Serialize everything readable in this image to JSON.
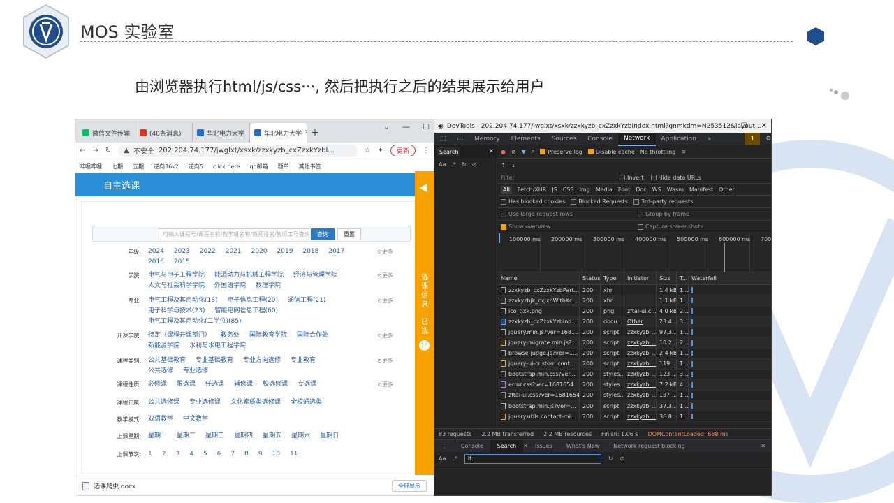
{
  "slide": {
    "title": "MOS 实验室",
    "subtitle": "由浏览器执行html/js/css···, 然后把执行之后的结果展示给用户"
  },
  "browser": {
    "tabs": [
      {
        "label": "微信文件传输",
        "color": "#07c160"
      },
      {
        "label": "(48条消息)",
        "color": "#d9381e"
      },
      {
        "label": "华北电力大学",
        "color": "#2b6ac6"
      },
      {
        "label": "华北电力大学",
        "color": "#2b6ac6"
      }
    ],
    "insecure": "不安全",
    "url": "202.204.74.177/jwglxt/xsxk/zzxkyzb_cxZzxkYzbl...",
    "update": "更新",
    "bookmarks": [
      "哔哩哔哩",
      "七期",
      "五期",
      "逆向36k2",
      "逆向5",
      "click here",
      "qq邮箱",
      "题单",
      "其他书签"
    ],
    "page_header": "自主选课",
    "search_placeholder": "可输入课程号/课程名称/教学班名称/教师姓名/教师工号查询",
    "query_btn": "查询",
    "reset_btn": "重置",
    "more": "⊙更多",
    "filters": [
      {
        "label": "年级:",
        "options": [
          "2024",
          "2023",
          "2022",
          "2021",
          "2020",
          "2019",
          "2018",
          "2017",
          "2016",
          "2015"
        ],
        "more": true
      },
      {
        "label": "学院:",
        "options": [
          "电气与电子工程学院",
          "能源动力与机械工程学院",
          "经济与管理学院",
          "人文与社会科学学院",
          "外国语学院",
          "数理学院"
        ],
        "more": true
      },
      {
        "label": "专业:",
        "options": [
          "电气工程及其自动化(18)",
          "电子信息工程(20)",
          "通信工程(21)",
          "电子科学与技术(23)",
          "智能电网信息工程(60)",
          "电气工程及其自动化(二学位)(85)"
        ],
        "more": true
      },
      {
        "label": "开课学院:",
        "options": [
          "待定（课程开课部门）",
          "教务处",
          "国际教育学院",
          "国际合作处",
          "新能源学院",
          "水利与水电工程学院"
        ],
        "more": true
      },
      {
        "label": "课程类别:",
        "options": [
          "公共基础教育",
          "专业基础教育",
          "专业方向选修",
          "专业教育",
          "公共选修",
          "专业选修"
        ],
        "more": true
      },
      {
        "label": "课程性质:",
        "options": [
          "必修课",
          "限选课",
          "任选课",
          "辅修课",
          "校选修课",
          "专选课"
        ],
        "more": true
      },
      {
        "label": "课程归属:",
        "options": [
          "公共选修课",
          "专业选修课",
          "文化素质类选修课",
          "全校通选类"
        ],
        "more": false
      },
      {
        "label": "教学模式:",
        "options": [
          "双语教学",
          "中文教学"
        ],
        "more": false
      },
      {
        "label": "上课星期:",
        "options": [
          "星期一",
          "星期二",
          "星期三",
          "星期四",
          "星期五",
          "星期六",
          "星期日"
        ],
        "more": false
      },
      {
        "label": "上课节次:",
        "options": [
          "1",
          "2",
          "3",
          "4",
          "5",
          "6",
          "7",
          "8",
          "9",
          "10",
          "11"
        ],
        "more": false
      }
    ],
    "side_selected": "选课信息",
    "side_selected2": "已选",
    "side_count": "13",
    "download_file": "选课爬虫.docx",
    "show_all": "全部显示"
  },
  "devtools": {
    "title": "DevTools - 202.204.74.177/jwglxt/xsxk/zzxkyzb_cxZzxkYzbIndex.html?gnmkdm=N253512&layout...",
    "tabs": [
      "Memory",
      "Elements",
      "Sources",
      "Console",
      "Network",
      "Application",
      "»"
    ],
    "active_tab": "Network",
    "issues_badge": "1",
    "search_label": "Search",
    "preserve_log": "Preserve log",
    "disable_cache": "Disable cache",
    "throttling": "No throttling",
    "filter_placeholder": "Filter",
    "invert": "Invert",
    "hide_data_urls": "Hide data URLs",
    "types": [
      "All",
      "Fetch/XHR",
      "JS",
      "CSS",
      "Img",
      "Media",
      "Font",
      "Doc",
      "WS",
      "Wasm",
      "Manifest",
      "Other"
    ],
    "has_blocked": "Has blocked cookies",
    "blocked_requests": "Blocked Requests",
    "third_party": "3rd-party requests",
    "large_rows": "Use large request rows",
    "group_frame": "Group by frame",
    "show_overview": "Show overview",
    "capture_screens": "Capture screenshots",
    "overview_ticks": [
      "100000 ms",
      "200000 ms",
      "300000 ms",
      "400000 ms",
      "500000 ms",
      "600000 ms",
      "700"
    ],
    "columns": [
      "Name",
      "Status",
      "Type",
      "Initiator",
      "Size",
      "T...",
      "Waterfall"
    ],
    "requests": [
      {
        "name": "zzxkyzb_cxZzxkYzbPart...",
        "status": "200",
        "type": "xhr",
        "initiator": "",
        "size": "1.4 kB",
        "time": "1...",
        "kind": "doc0"
      },
      {
        "name": "zzxkyzbjk_cxJxbWithKc...",
        "status": "200",
        "type": "xhr",
        "initiator": "",
        "size": "1.1 kB",
        "time": "1...",
        "kind": "doc0"
      },
      {
        "name": "ico_tjxk.png",
        "status": "200",
        "type": "png",
        "initiator": "zftal-ui.c...",
        "size": "4.0 kB",
        "time": "2...",
        "kind": "img"
      },
      {
        "name": "zzxkyzb_cxZzxkYzbInd...",
        "status": "200",
        "type": "docu...",
        "initiator": "Other",
        "size": "23.4...",
        "time": "3...",
        "kind": "doc"
      },
      {
        "name": "jquery.min.js?ver=1681...",
        "status": "200",
        "type": "script",
        "initiator": "zzxkyzb_...",
        "size": "97.3...",
        "time": "1...",
        "kind": "js"
      },
      {
        "name": "jquery-migrate.min.js?...",
        "status": "200",
        "type": "script",
        "initiator": "zzxkyzb_...",
        "size": "10.2...",
        "time": "2...",
        "kind": "js"
      },
      {
        "name": "browse-judge.js?ver=1...",
        "status": "200",
        "type": "script",
        "initiator": "zzxkyzb_...",
        "size": "2.4 kB",
        "time": "1...",
        "kind": "js"
      },
      {
        "name": "jquery-ui-custom.cont...",
        "status": "200",
        "type": "script",
        "initiator": "zzxkyzb_...",
        "size": "119 ...",
        "time": "1...",
        "kind": "js"
      },
      {
        "name": "bootstrap.min.css?ver...",
        "status": "200",
        "type": "styles...",
        "initiator": "zzxkyzb_...",
        "size": "123 ...",
        "time": "3...",
        "kind": "css"
      },
      {
        "name": "error.css?ver=1681654",
        "status": "200",
        "type": "styles...",
        "initiator": "zzxkyzb_...",
        "size": "7.2 kB",
        "time": "4...",
        "kind": "css"
      },
      {
        "name": "zftal-ui.css?ver=1681654",
        "status": "200",
        "type": "styles...",
        "initiator": "zzxkyzb_...",
        "size": "137 ...",
        "time": "1...",
        "kind": "css"
      },
      {
        "name": "bootstrap.min.js?ver=...",
        "status": "200",
        "type": "script",
        "initiator": "zzxkyzb_...",
        "size": "37.3...",
        "time": "1...",
        "kind": "js"
      },
      {
        "name": "jquery.utils.contact-mi...",
        "status": "200",
        "type": "script",
        "initiator": "zzxkyzb_...",
        "size": "36.8...",
        "time": "1...",
        "kind": "js"
      }
    ],
    "status": {
      "requests": "83 requests",
      "transferred": "2.2 MB transferred",
      "resources": "2.2 MB resources",
      "finish": "Finish: 1.06 s",
      "dcl": "DOMContentLoaded: 688 ms"
    },
    "drawer_tabs": [
      "Console",
      "Search",
      "Issues",
      "What's New",
      "Network request blocking"
    ],
    "drawer_active": "Search",
    "drawer_query": "lt:"
  }
}
